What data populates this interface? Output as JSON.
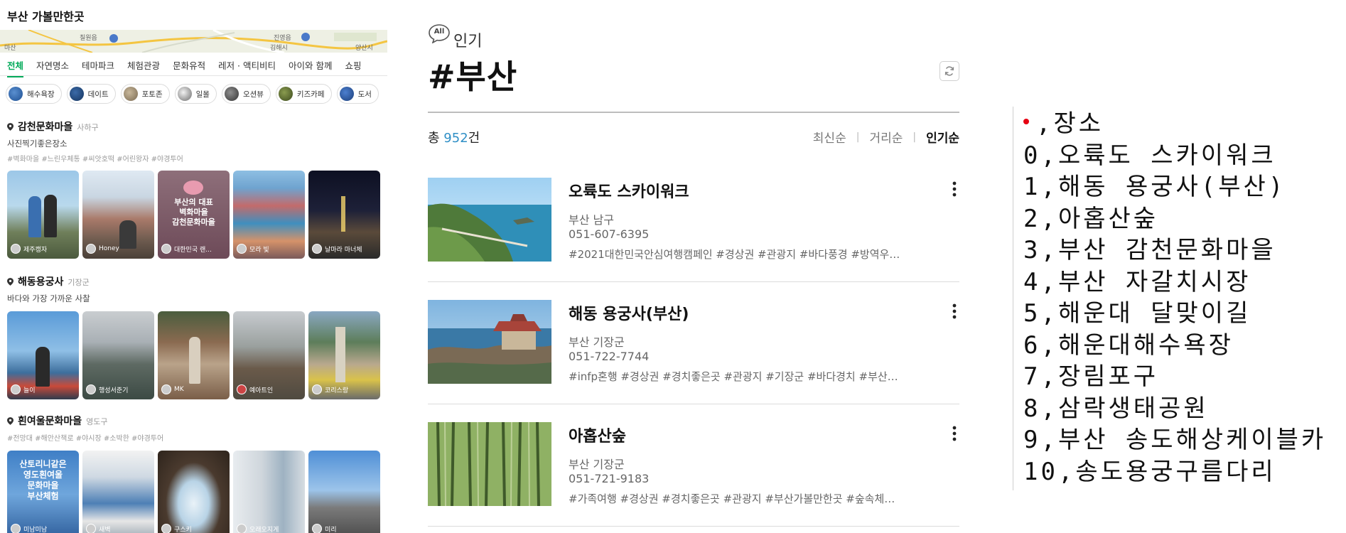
{
  "left_panel": {
    "title": "부산 가볼만한곳",
    "map_labels": [
      "칠원읍",
      "진영읍",
      "김해시",
      "양산시",
      "마산"
    ],
    "category_tabs": [
      "전체",
      "자연명소",
      "테마파크",
      "체험관광",
      "문화유적",
      "레저 · 액티비티",
      "아이와 함께",
      "쇼핑"
    ],
    "active_tab": "전체",
    "chips": [
      "해수욕장",
      "데이트",
      "포토존",
      "일몰",
      "오션뷰",
      "키즈카페",
      "도서"
    ],
    "places": [
      {
        "name": "감천문화마을",
        "district": "사하구",
        "desc": "사진찍기좋은장소",
        "tags": "#벽화마을 #느린우체통 #씨앗호떡 #어린왕자 #야경투어",
        "photos": [
          {
            "user": "제주캥자",
            "overlay": ""
          },
          {
            "user": "Honey",
            "overlay": ""
          },
          {
            "user": "대한민국 랜...",
            "overlay": "부산의 대표\n벽화마을\n감천문화마을"
          },
          {
            "user": "모라 빛",
            "overlay": ""
          },
          {
            "user": "날마라 마너체",
            "overlay": ""
          }
        ]
      },
      {
        "name": "해동용궁사",
        "district": "기장군",
        "desc": "바다와 가장 가까운 사찰",
        "tags": "",
        "photos": [
          {
            "user": "늘이",
            "overlay": ""
          },
          {
            "user": "행성서준기",
            "overlay": ""
          },
          {
            "user": "MK",
            "overlay": ""
          },
          {
            "user": "예아트인",
            "overlay": ""
          },
          {
            "user": "코리스랑",
            "overlay": ""
          }
        ]
      },
      {
        "name": "흰여울문화마을",
        "district": "영도구",
        "desc": "",
        "tags": "#전망대 #해안산책로 #야시장 #소박한 #야경투어",
        "photos": [
          {
            "user": "미남미남",
            "overlay": "산토리니같은\n영도흰여울\n문화마을\n부산체험"
          },
          {
            "user": "새벽",
            "overlay": ""
          },
          {
            "user": "구스키",
            "overlay": ""
          },
          {
            "user": "오래오지게",
            "overlay": ""
          },
          {
            "user": "미리",
            "overlay": ""
          }
        ]
      }
    ]
  },
  "main": {
    "badge": "All",
    "section_label": "인기",
    "hashtag_title": "#부산",
    "total_prefix": "총",
    "total_count": "952",
    "total_suffix": "건",
    "sort_options": [
      "최신순",
      "거리순",
      "인기순"
    ],
    "active_sort": "인기순",
    "results": [
      {
        "name": "오륙도 스카이워크",
        "location": "부산 남구",
        "phone": "051-607-6395",
        "tags": "#2021대한민국안심여행캠페인 #경상권 #관광지 #바다풍경 #방역우…"
      },
      {
        "name": "해동 용궁사(부산)",
        "location": "부산 기장군",
        "phone": "051-722-7744",
        "tags": "#infp혼행 #경상권 #경치좋은곳 #관광지 #기장군 #바다경치 #부산…"
      },
      {
        "name": "아홉산숲",
        "location": "부산 기장군",
        "phone": "051-721-9183",
        "tags": "#가족여행 #경상권 #경치좋은곳 #관광지 #부산가볼만한곳 #숲속체…"
      }
    ]
  },
  "ranking": {
    "header": ",장소",
    "items": [
      "0,오륙도 스카이워크",
      "1,해동 용궁사(부산)",
      "2,아홉산숲",
      "3,부산 감천문화마을",
      "4,부산 자갈치시장",
      "5,해운대 달맞이길",
      "6,해운대해수욕장",
      "7,장림포구",
      "8,삼락생태공원",
      "9,부산 송도해상케이블카",
      "10,송도용궁구름다리"
    ]
  },
  "colors": {
    "active_tab": "#03aa5a",
    "count": "#2f8fc6",
    "bullet": "#e60012"
  }
}
